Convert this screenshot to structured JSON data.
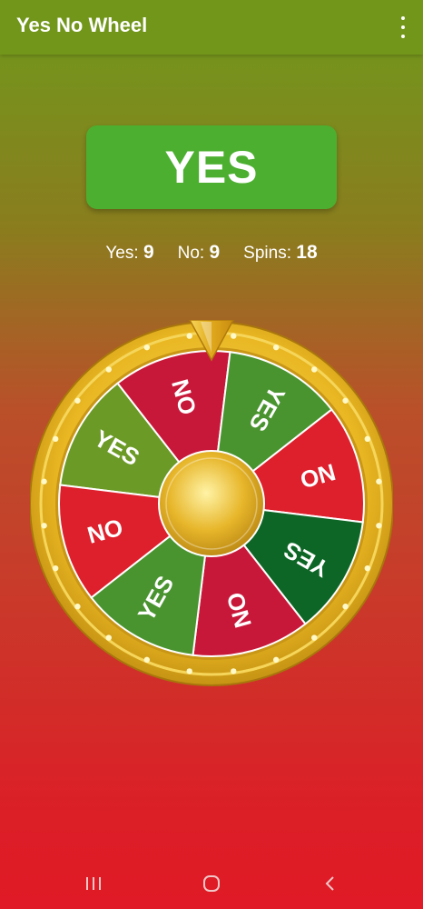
{
  "app": {
    "title": "Yes No Wheel"
  },
  "result": {
    "label": "YES",
    "color": "#4caf30"
  },
  "stats": {
    "yes_label": "Yes:",
    "yes_count": "9",
    "no_label": "No:",
    "no_count": "9",
    "spins_label": "Spins:",
    "spins_count": "18"
  },
  "wheel": {
    "segments": [
      {
        "label": "YES",
        "color": "#6c9a26"
      },
      {
        "label": "NO",
        "color": "#c8183a"
      },
      {
        "label": "YES",
        "color": "#4a9430"
      },
      {
        "label": "NO",
        "color": "#de1f2c"
      },
      {
        "label": "YES",
        "color": "#0e6626"
      },
      {
        "label": "NO",
        "color": "#c8183a"
      },
      {
        "label": "YES",
        "color": "#4a9430"
      },
      {
        "label": "NO",
        "color": "#de1f2c"
      }
    ],
    "rim_color": "#e3b01e",
    "hub_color": "#e4b324"
  },
  "icons": {
    "menu": "more-vert-icon",
    "pointer": "pointer-arrow-icon",
    "recent": "recent-apps-icon",
    "home": "home-icon",
    "back": "back-icon"
  }
}
